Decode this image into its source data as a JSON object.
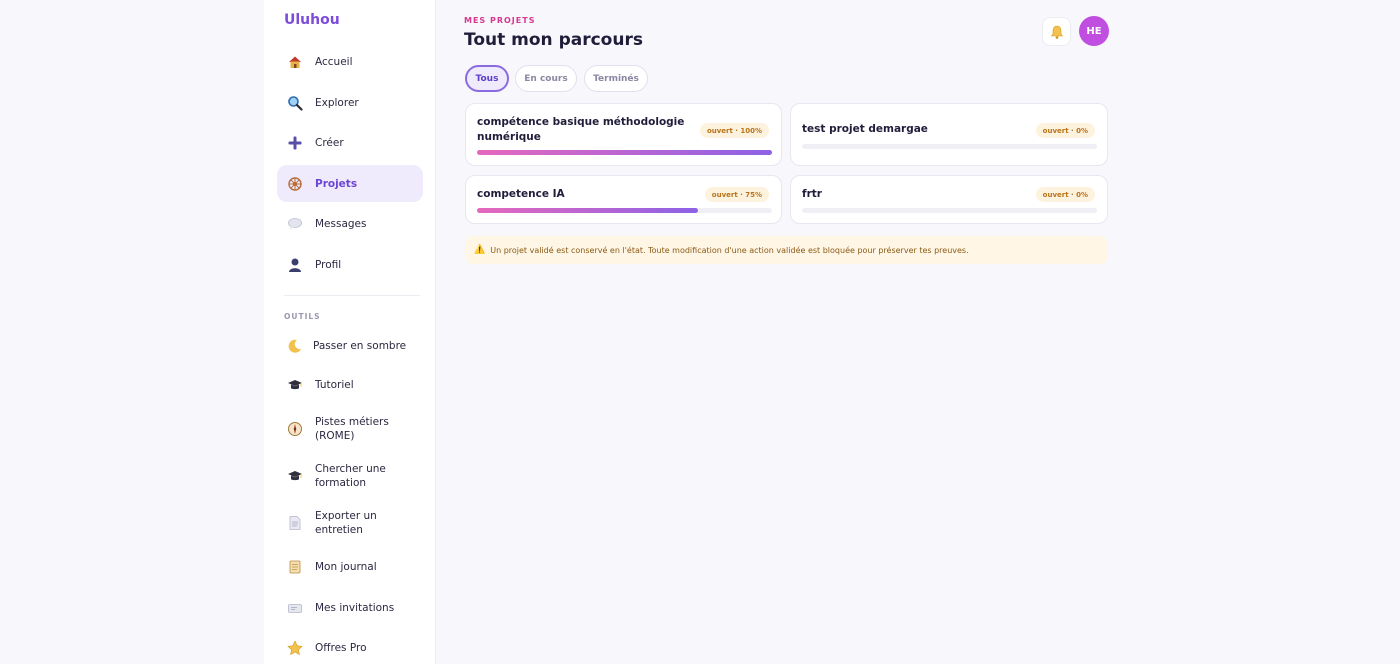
{
  "sidebar": {
    "brand": "Uluhou",
    "items": [
      {
        "label": "Accueil",
        "icon": "house-icon"
      },
      {
        "label": "Explorer",
        "icon": "magnifier-icon"
      },
      {
        "label": "Créer",
        "icon": "plus-icon"
      },
      {
        "label": "Projets",
        "icon": "wheel-icon",
        "active": true
      },
      {
        "label": "Messages",
        "icon": "speech-bubble-icon"
      },
      {
        "label": "Profil",
        "icon": "person-icon"
      }
    ],
    "tools_section_label": "OUTILS",
    "tools": [
      {
        "label": "Passer en sombre",
        "icon": "moon-icon"
      },
      {
        "label": "Tutoriel",
        "icon": "graduation-cap-icon"
      },
      {
        "label": "Pistes métiers (ROME)",
        "icon": "compass-icon"
      },
      {
        "label": "Chercher une formation",
        "icon": "graduation-cap-icon"
      },
      {
        "label": "Exporter un entretien",
        "icon": "document-icon"
      },
      {
        "label": "Mon journal",
        "icon": "scroll-icon"
      },
      {
        "label": "Mes invitations",
        "icon": "ticket-icon"
      },
      {
        "label": "Offres Pro",
        "icon": "star-icon"
      }
    ]
  },
  "header": {
    "kicker": "MES PROJETS",
    "title": "Tout mon parcours",
    "avatar_initials": "HE",
    "bell_icon": "bell-icon"
  },
  "filters": [
    {
      "label": "Tous",
      "active": true
    },
    {
      "label": "En cours",
      "active": false
    },
    {
      "label": "Terminés",
      "active": false
    }
  ],
  "projects": [
    {
      "title": "compétence basique méthodologie numérique",
      "badge": "ouvert · 100%",
      "progress": 100
    },
    {
      "title": "test projet demargae",
      "badge": "ouvert · 0%",
      "progress": 0
    },
    {
      "title": "competence IA",
      "badge": "ouvert · 75%",
      "progress": 75
    },
    {
      "title": "frtr",
      "badge": "ouvert · 0%",
      "progress": 0
    }
  ],
  "notice": {
    "icon": "warning-icon",
    "text": "Un projet validé est conservé en l'état. Toute modification d'une action validée est bloquée pour préserver tes preuves."
  },
  "colors": {
    "accent": "#7c4ddb",
    "kicker": "#d6398f",
    "avatar": "#c04ee0",
    "badge_bg": "#fdf2de",
    "progress_start": "#e568bd",
    "progress_end": "#8d62e6"
  }
}
